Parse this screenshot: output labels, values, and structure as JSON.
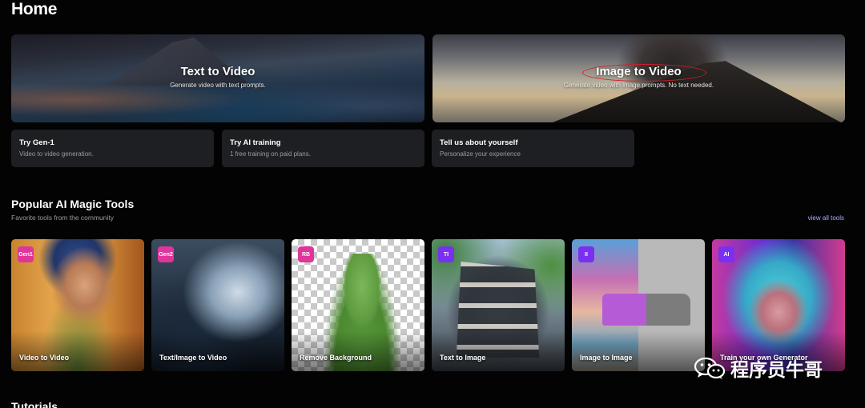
{
  "page": {
    "title": "Home"
  },
  "hero": [
    {
      "title": "Text to Video",
      "subtitle": "Generate video with text prompts."
    },
    {
      "title": "Image to Video",
      "subtitle": "Generate video with image prompts. No text needed."
    }
  ],
  "quick_cards": [
    {
      "title": "Try Gen-1",
      "subtitle": "Video to video generation."
    },
    {
      "title": "Try AI training",
      "subtitle": "1 free training on paid plans."
    },
    {
      "title": "Tell us about yourself",
      "subtitle": "Personalize your experience"
    }
  ],
  "popular": {
    "title": "Popular AI Magic Tools",
    "subtitle": "Favorite tools from the community",
    "view_all": "view all tools",
    "tools": [
      {
        "badge": "Gen1",
        "label": "Video to Video",
        "badge_color": "#e0359a"
      },
      {
        "badge": "Gen2",
        "label": "Text/Image to Video",
        "badge_color": "#e0359a"
      },
      {
        "badge": "RB",
        "label": "Remove Background",
        "badge_color": "#e0359a"
      },
      {
        "badge": "TI",
        "label": "Text to Image",
        "badge_color": "#7b2ff0"
      },
      {
        "badge": "II",
        "label": "Image to Image",
        "badge_color": "#7b2ff0"
      },
      {
        "badge": "AI",
        "label": "Train your own Generator",
        "badge_color": "#7b2ff0"
      }
    ]
  },
  "tutorials": {
    "title": "Tutorials"
  },
  "watermark": {
    "text": "程序员牛哥",
    "icon": "wechat-icon"
  },
  "colors": {
    "background": "#030303",
    "card": "#1e1f23",
    "link": "#a9b2ff",
    "annotation": "#d01f2a"
  }
}
